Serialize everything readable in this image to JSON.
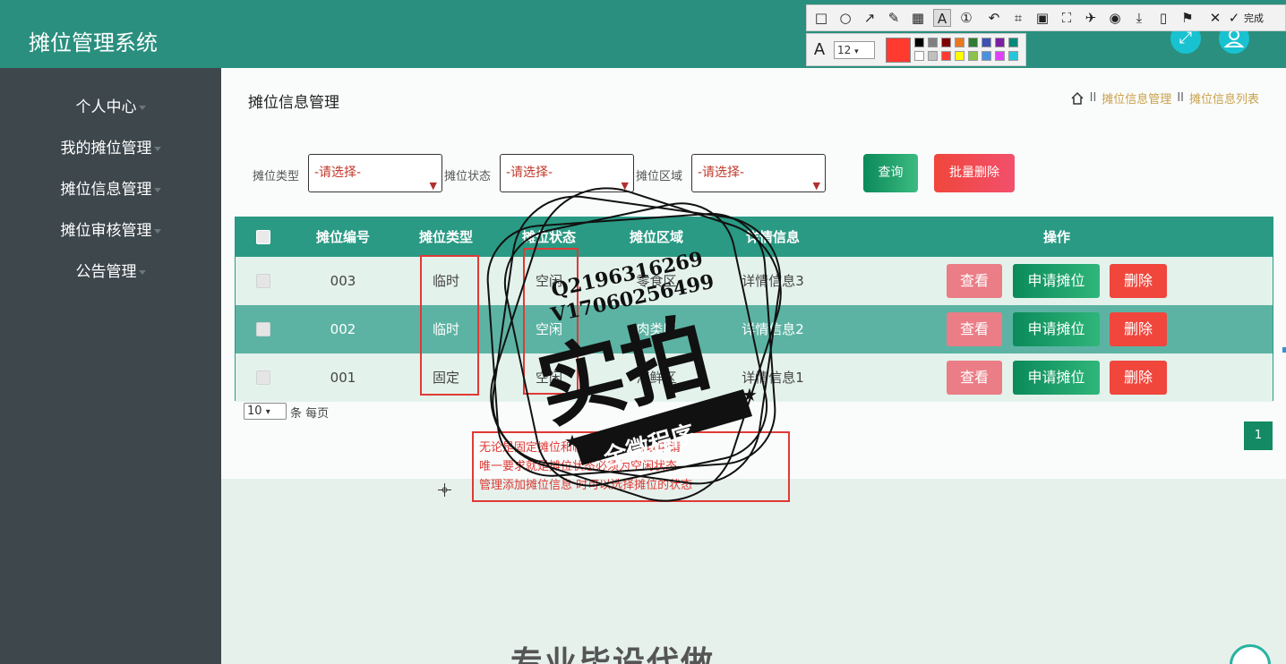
{
  "header": {
    "title": "摊位管理系统"
  },
  "sidebar": {
    "items": [
      {
        "label": "个人中心"
      },
      {
        "label": "我的摊位管理"
      },
      {
        "label": "摊位信息管理"
      },
      {
        "label": "摊位审核管理"
      },
      {
        "label": "公告管理"
      }
    ]
  },
  "page": {
    "title": "摊位信息管理",
    "breadcrumb": {
      "sep": "II",
      "level1": "摊位信息管理",
      "level2": "摊位信息列表"
    }
  },
  "filters": {
    "type_label": "摊位类型",
    "status_label": "摊位状态",
    "area_label": "摊位区域",
    "type_value": "-请选择-",
    "status_value": "-请选择-",
    "area_value": "-请选择-",
    "query_label": "查询",
    "batch_delete_label": "批量删除"
  },
  "table": {
    "headers": {
      "code": "摊位编号",
      "type": "摊位类型",
      "status": "摊位状态",
      "area": "摊位区域",
      "detail": "详情信息",
      "actions": "操作"
    },
    "rows": [
      {
        "code": "003",
        "type": "临时",
        "status": "空闲",
        "area": "零食区",
        "detail": "详情信息3"
      },
      {
        "code": "002",
        "type": "临时",
        "status": "空闲",
        "area": "肉类区",
        "detail": "详情信息2"
      },
      {
        "code": "001",
        "type": "固定",
        "status": "空闲",
        "area": "海鲜区",
        "detail": "详情信息1"
      }
    ],
    "action_labels": {
      "view": "查看",
      "apply": "申请摊位",
      "delete": "删除"
    }
  },
  "pagination": {
    "page_size": "10",
    "page_size_suffix": "条 每页",
    "current_page": "1"
  },
  "annotation": {
    "lines": [
      "无论是固定摊位和临时摊位 都可以申请",
      "唯一要求就是摊位状态必须为空闲状态",
      "管理添加摊位信息 时可以选择摊位的状态"
    ]
  },
  "watermark": {
    "contact1": "Q2196316269",
    "contact2": "V17060256499",
    "main": "实拍",
    "banner": "全微程序"
  },
  "screenshot_toolbar": {
    "done_label": "完成",
    "font_size": "12",
    "current_color": "#ff3b30",
    "palette": [
      "#000000",
      "#808080",
      "#800000",
      "#e87722",
      "#2e7d32",
      "#3f51b5",
      "#7b1fa2",
      "#00897b",
      "#ffffff",
      "#c0c0c0",
      "#ff3b30",
      "#ffff00",
      "#8bc34a",
      "#4a90e2",
      "#e040fb",
      "#26c6da"
    ]
  },
  "bottom_text": "专业毕设代做",
  "colors": {
    "header": "#2a8f7e",
    "sidebar": "#3d474c",
    "accent_green": "#138a64",
    "accent_red": "#f0463c"
  }
}
